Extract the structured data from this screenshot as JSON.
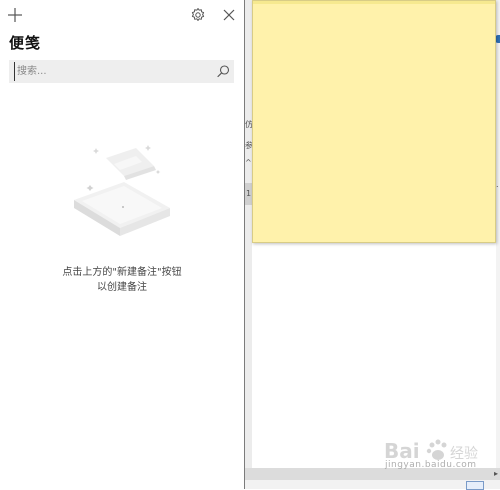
{
  "notes_panel": {
    "title": "便笺",
    "search": {
      "placeholder": "搜索..."
    },
    "empty_state": {
      "line1": "点击上方的\"新建备注\"按钮",
      "line2": "以创建备注"
    },
    "icons": {
      "add": "plus-icon",
      "settings": "gear-icon",
      "close": "close-icon",
      "search": "search-icon"
    }
  },
  "sticky_note": {
    "color": "#fff2ab",
    "content": ""
  },
  "background_app": {
    "fragments": [
      "仿",
      "参",
      "^",
      "1"
    ]
  },
  "watermark": {
    "text": "jingyan.baidu.com"
  }
}
